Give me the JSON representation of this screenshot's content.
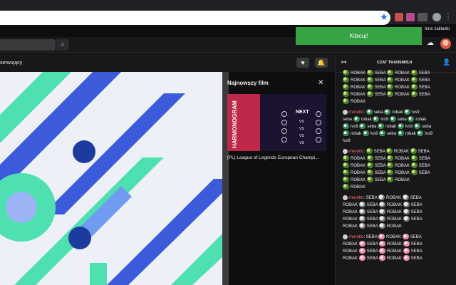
{
  "browser": {
    "other_bookmarks": "Inne zakładki",
    "colors": {
      "frame": "#202124",
      "star": "#1a73e8"
    }
  },
  "twitch": {
    "search_icon": "search-icon",
    "kibicuj": "Kibicuj!",
    "following": "serwujący",
    "heart_icon": "heart-icon",
    "bell_icon": "bell-icon",
    "accent": "#36a345"
  },
  "panel": {
    "title": "Najnowszy film",
    "close_icon": "close-icon",
    "thumb_text": "HARMONOGRAM",
    "thumb_next": "NEXT",
    "thumb_vs": [
      "VS",
      "VS",
      "VS",
      "VS"
    ],
    "caption": "[PL] League of Legends European Champi..."
  },
  "chat": {
    "title": "CZAT TRANSMISJI",
    "lines": [
      [
        {
          "e": "fr",
          "t": "ROBAK"
        },
        {
          "e": "fr",
          "t": "SEBA"
        },
        {
          "e": "fr",
          "t": "ROBAK"
        },
        {
          "e": "fr",
          "t": "SEBA"
        }
      ],
      [
        {
          "e": "fr",
          "t": "ROBAK"
        },
        {
          "e": "fr",
          "t": "SEBA"
        },
        {
          "e": "fr",
          "t": "ROBAK"
        },
        {
          "e": "fr",
          "t": "SEBA"
        }
      ],
      [
        {
          "e": "fr",
          "t": "ROBAK"
        },
        {
          "e": "fr",
          "t": "SEBA"
        },
        {
          "e": "fr",
          "t": "ROBAK"
        },
        {
          "e": "fr",
          "t": "SEBA"
        }
      ],
      [
        {
          "e": "fr",
          "t": "ROBAK"
        },
        {
          "e": "fr",
          "t": "SEBA"
        },
        {
          "e": "fr",
          "t": "ROBAK"
        },
        {
          "e": "fr",
          "t": "SEBA"
        }
      ],
      [
        {
          "e": "fr",
          "t": "ROBAK"
        }
      ],
      [
        {
          "u": "meretto"
        },
        {
          "e": "cy",
          "t": "seba"
        },
        {
          "e": "cy",
          "t": "robak"
        },
        {
          "e": "cy",
          "t": "lvs9"
        }
      ],
      [
        {
          "t": "seba"
        },
        {
          "e": "cy",
          "t": "robak"
        },
        {
          "e": "cy",
          "t": "lvs9"
        },
        {
          "e": "cy",
          "t": "seba"
        },
        {
          "e": "cy",
          "t": "robak"
        }
      ],
      [
        {
          "e": "cy",
          "t": "lvs9"
        },
        {
          "e": "cy",
          "t": "seba"
        },
        {
          "e": "cy",
          "t": "robak"
        },
        {
          "e": "cy",
          "t": "lvs9"
        },
        {
          "e": "cy",
          "t": "seba"
        }
      ],
      [
        {
          "e": "cy",
          "t": "robak"
        },
        {
          "e": "cy",
          "t": "lvs9"
        },
        {
          "e": "cy",
          "t": "seba"
        },
        {
          "e": "cy",
          "t": "robak"
        },
        {
          "e": "cy",
          "t": "lvs9"
        }
      ],
      [
        {
          "t": "lvs9"
        }
      ],
      [
        {
          "u": "meretto"
        },
        {
          "e": "fr",
          "t": "SEBA"
        },
        {
          "e": "fr",
          "t": "ROBAK"
        },
        {
          "e": "fr",
          "t": "SEBA"
        }
      ],
      [
        {
          "e": "fr",
          "t": "ROBAK"
        },
        {
          "e": "fr",
          "t": "SEBA"
        },
        {
          "e": "fr",
          "t": "ROBAK"
        },
        {
          "e": "fr",
          "t": "SEBA"
        }
      ],
      [
        {
          "e": "fr",
          "t": "ROBAK"
        },
        {
          "e": "fr",
          "t": "SEBA"
        },
        {
          "e": "fr",
          "t": "ROBAK"
        },
        {
          "e": "fr",
          "t": "SEBA"
        }
      ],
      [
        {
          "e": "fr",
          "t": "ROBAK"
        },
        {
          "e": "fr",
          "t": "SEBA"
        },
        {
          "e": "fr",
          "t": "ROBAK"
        },
        {
          "e": "fr",
          "t": "SEBA"
        }
      ],
      [
        {
          "e": "fr",
          "t": "ROBAK"
        },
        {
          "e": "fr",
          "t": "SEBA"
        },
        {
          "e": "fr",
          "t": "ROBAK"
        }
      ],
      [
        {
          "e": "fr",
          "t": "ROBAK"
        }
      ],
      [
        {
          "u": "meretto"
        },
        {
          "t": "SEBA"
        },
        {
          "e": "pp",
          "t": "ROBAK"
        },
        {
          "e": "pp",
          "t": "SEBA"
        }
      ],
      [
        {
          "t": "ROBAK"
        },
        {
          "e": "pp",
          "t": "SEBA"
        },
        {
          "e": "pp",
          "t": "ROBAK"
        },
        {
          "e": "pp",
          "t": "SEBA"
        }
      ],
      [
        {
          "t": "ROBAK"
        },
        {
          "e": "pp",
          "t": "SEBA"
        },
        {
          "e": "pp",
          "t": "ROBAK"
        },
        {
          "e": "pp",
          "t": "SEBA"
        }
      ],
      [
        {
          "t": "ROBAK"
        },
        {
          "e": "pp",
          "t": "SEBA"
        },
        {
          "e": "pp",
          "t": "ROBAK"
        },
        {
          "e": "pp",
          "t": "SEBA"
        }
      ],
      [
        {
          "t": "ROBAK"
        },
        {
          "e": "pp",
          "t": "SEBA"
        },
        {
          "e": "pp",
          "t": "ROBAK"
        }
      ],
      [
        {
          "u": "meretto"
        },
        {
          "t": "SEBA"
        },
        {
          "e": "pk",
          "t": "ROBAK"
        },
        {
          "e": "pk",
          "t": "SEBA"
        }
      ],
      [
        {
          "t": "ROBAK"
        },
        {
          "e": "pk",
          "t": "SEBA"
        },
        {
          "e": "pk",
          "t": "ROBAK"
        },
        {
          "e": "pk",
          "t": "SEBA"
        }
      ],
      [
        {
          "t": "ROBAK"
        },
        {
          "e": "pk",
          "t": "SEBA"
        },
        {
          "e": "pk",
          "t": "ROBAK"
        },
        {
          "e": "pk",
          "t": "SEBA"
        }
      ],
      [
        {
          "t": "ROBAK"
        },
        {
          "e": "pk",
          "t": "SEBA"
        },
        {
          "e": "pk",
          "t": "ROBAK"
        },
        {
          "e": "pk",
          "t": "SEBA"
        }
      ]
    ]
  }
}
